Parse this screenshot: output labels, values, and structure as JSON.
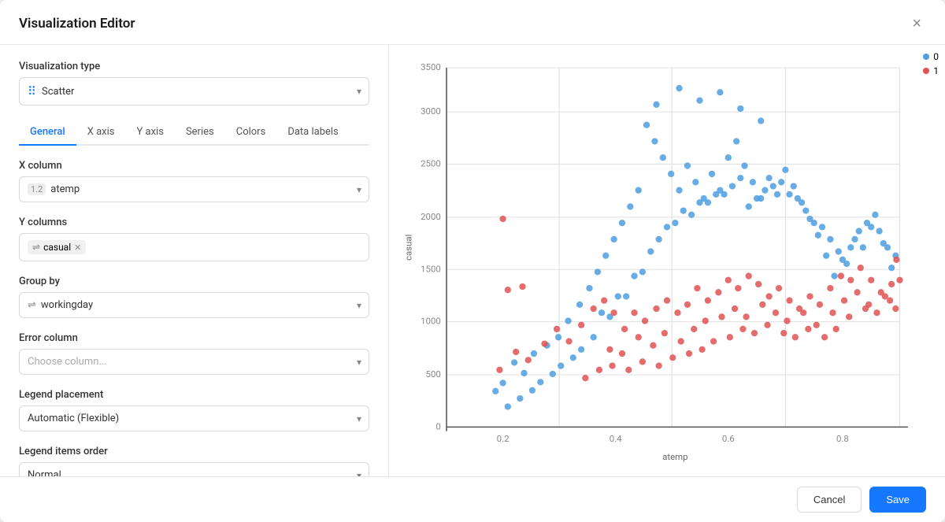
{
  "modal": {
    "title": "Visualization Editor",
    "close_label": "×"
  },
  "left": {
    "viz_type_label": "Visualization type",
    "viz_type_value": "Scatter",
    "viz_type_icon": "⠿",
    "tabs": [
      {
        "id": "general",
        "label": "General",
        "active": true
      },
      {
        "id": "xaxis",
        "label": "X axis",
        "active": false
      },
      {
        "id": "yaxis",
        "label": "Y axis",
        "active": false
      },
      {
        "id": "series",
        "label": "Series",
        "active": false
      },
      {
        "id": "colors",
        "label": "Colors",
        "active": false
      },
      {
        "id": "datalabels",
        "label": "Data labels",
        "active": false
      }
    ],
    "x_column_label": "X column",
    "x_column_value": "atemp",
    "x_column_icon": "1.2",
    "y_columns_label": "Y columns",
    "y_columns_tags": [
      {
        "label": "casual",
        "icon": "⇌"
      }
    ],
    "group_by_label": "Group by",
    "group_by_value": "workingday",
    "group_by_icon": "⇌",
    "error_column_label": "Error column",
    "error_column_placeholder": "Choose column...",
    "legend_placement_label": "Legend placement",
    "legend_placement_value": "Automatic (Flexible)",
    "legend_items_label": "Legend items order",
    "legend_items_value": "Normal"
  },
  "chart": {
    "x_axis_label": "atemp",
    "y_axis_label": "casual",
    "x_ticks": [
      "0.2",
      "0.4",
      "0.6",
      "0.8"
    ],
    "y_ticks": [
      "0",
      "500",
      "1000",
      "1500",
      "2000",
      "2500",
      "3000",
      "3500"
    ],
    "legend": [
      {
        "label": "0",
        "color": "#4e9de0"
      },
      {
        "label": "1",
        "color": "#e05252"
      }
    ]
  },
  "footer": {
    "cancel_label": "Cancel",
    "save_label": "Save"
  }
}
